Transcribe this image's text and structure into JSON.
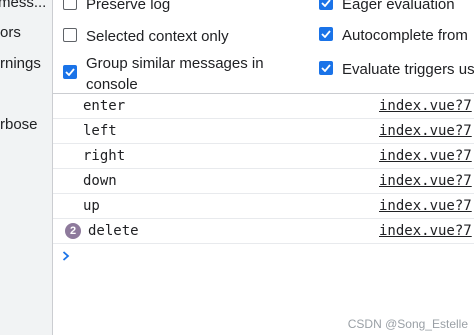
{
  "sidebar": {
    "items": [
      {
        "label": "mess..."
      },
      {
        "label": "ors"
      },
      {
        "label": "rnings"
      },
      {
        "label": "rbose"
      }
    ]
  },
  "settings": {
    "left": [
      {
        "label": "Preserve log",
        "checked": false
      },
      {
        "label": "Selected context only",
        "checked": false
      },
      {
        "label_line1": "Group similar messages in",
        "label_line2": "console",
        "checked": true
      }
    ],
    "right": [
      {
        "label": "Eager evaluation",
        "checked": true
      },
      {
        "label": "Autocomplete from",
        "checked": true
      },
      {
        "label": "Evaluate triggers us",
        "checked": true
      }
    ]
  },
  "console": {
    "messages": [
      {
        "text": "enter",
        "source": "index.vue?7"
      },
      {
        "text": "left",
        "source": "index.vue?7"
      },
      {
        "text": "right",
        "source": "index.vue?7"
      },
      {
        "text": "down",
        "source": "index.vue?7"
      },
      {
        "text": "up",
        "source": "index.vue?7"
      },
      {
        "text": "delete",
        "source": "index.vue?7",
        "count": "2"
      }
    ],
    "prompt_symbol": "›"
  },
  "watermark": "CSDN @Song_Estelle",
  "colors": {
    "accent": "#1a73e8",
    "badge": "#8e7a9c",
    "sidebar_bg": "#f1f3f4"
  }
}
